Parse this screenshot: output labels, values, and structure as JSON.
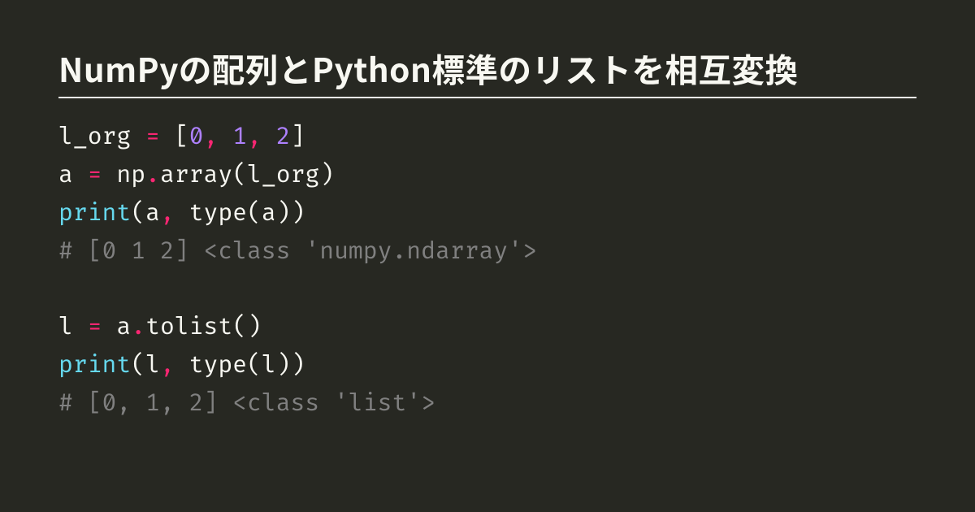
{
  "title": "NumPyの配列とPython標準のリストを相互変換",
  "code": {
    "l1": {
      "var": "l_org ",
      "eq": "=",
      "lb": " [",
      "n0": "0",
      "c0": ",",
      "s0": " ",
      "n1": "1",
      "c1": ",",
      "s1": " ",
      "n2": "2",
      "rb": "]"
    },
    "l2": {
      "var": "a ",
      "eq": "=",
      "sp": " np",
      "dot": ".",
      "fn": "array(l_org)"
    },
    "l3": {
      "print": "print",
      "rest1": "(a",
      "comma": ",",
      "rest2": " type(a))"
    },
    "l4": {
      "cmt": "# [0 1 2] <class 'numpy.ndarray'>"
    },
    "l6": {
      "var": "l ",
      "eq": "=",
      "sp": " a",
      "dot": ".",
      "fn": "tolist()"
    },
    "l7": {
      "print": "print",
      "rest1": "(l",
      "comma": ",",
      "rest2": " type(l))"
    },
    "l8": {
      "cmt": "# [0, 1, 2] <class 'list'>"
    }
  }
}
